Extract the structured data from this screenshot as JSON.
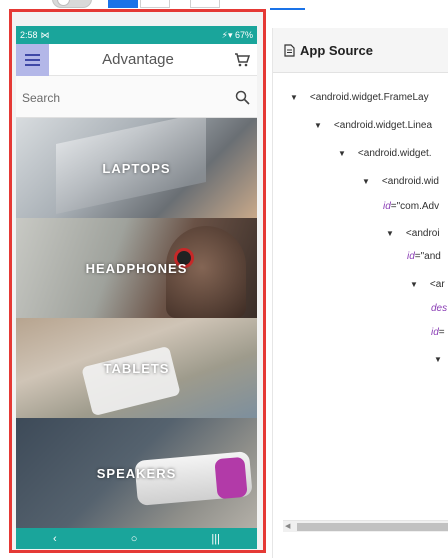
{
  "status_bar": {
    "time": "2:58",
    "indicators": "67%"
  },
  "app_bar": {
    "title": "Advantage"
  },
  "search": {
    "placeholder": "Search"
  },
  "categories": [
    {
      "label": "LAPTOPS"
    },
    {
      "label": "HEADPHONES"
    },
    {
      "label": "TABLETS"
    },
    {
      "label": "SPEAKERS"
    }
  ],
  "nav_bar": {
    "back": "‹",
    "home": "○",
    "recents": "|||"
  },
  "source_panel": {
    "title": "App Source",
    "tree": [
      {
        "text": "<android.widget.FrameLay"
      },
      {
        "text": "<android.widget.Linea"
      },
      {
        "text": "<android.widget."
      },
      {
        "text": "<android.wid"
      },
      {
        "attr": "id",
        "value": "=\"com.Adv"
      },
      {
        "text": "<androi"
      },
      {
        "attr": "id",
        "value": "=\"and"
      },
      {
        "text": "<ar"
      },
      {
        "attr": "des",
        "value": ""
      },
      {
        "attr": "id",
        "value": "="
      }
    ]
  },
  "colors": {
    "accent": "#1aa59b",
    "frame_highlight": "#e53935",
    "menu_button": "#b3b7e8",
    "tab_active": "#1a73e8"
  }
}
